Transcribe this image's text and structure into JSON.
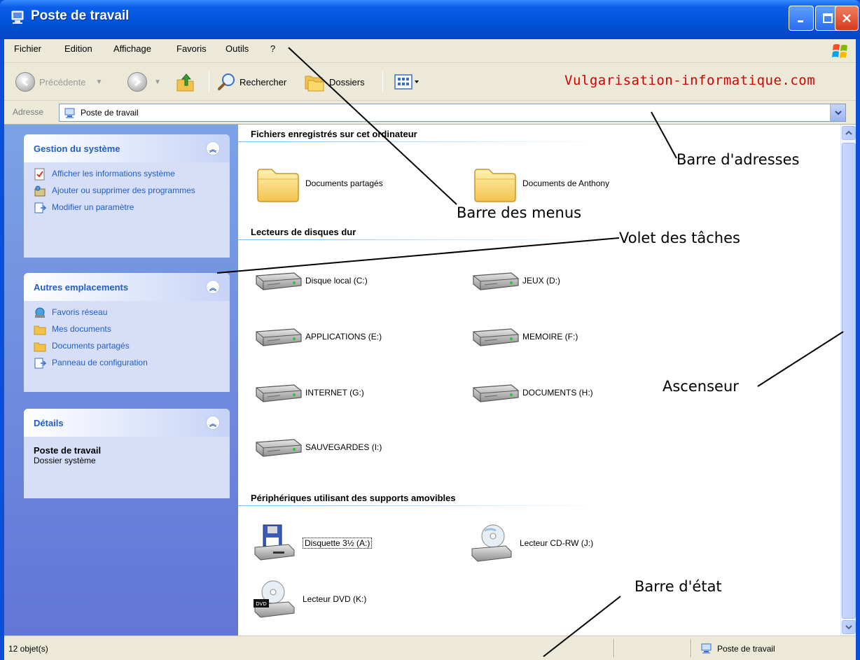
{
  "window": {
    "title": "Poste de travail",
    "title_icon": "computer-icon",
    "controls": [
      "minimize-icon",
      "maximize-icon",
      "close-icon"
    ]
  },
  "menubar": {
    "items": [
      "Fichier",
      "Edition",
      "Affichage",
      "Favoris",
      "Outils",
      "?"
    ]
  },
  "toolbar": {
    "back_label": "Précédente",
    "search_label": "Rechercher",
    "folders_label": "Dossiers",
    "brand": "Vulgarisation-informatique.com",
    "brand_color": "#d40000"
  },
  "address": {
    "label": "Adresse",
    "value": "Poste de travail"
  },
  "tasks": {
    "system": {
      "title": "Gestion du système",
      "items": [
        {
          "label": "Afficher les informations système",
          "icon": "info-icon"
        },
        {
          "label": "Ajouter ou supprimer des programmes",
          "icon": "add-remove-icon"
        },
        {
          "label": "Modifier un paramètre",
          "icon": "control-panel-icon"
        }
      ]
    },
    "places": {
      "title": "Autres emplacements",
      "items": [
        {
          "label": "Favoris réseau",
          "icon": "network-icon"
        },
        {
          "label": "Mes documents",
          "icon": "folder-icon"
        },
        {
          "label": "Documents partagés",
          "icon": "folder-icon"
        },
        {
          "label": "Panneau de configuration",
          "icon": "control-panel-icon"
        }
      ]
    },
    "details": {
      "title": "Détails",
      "name": "Poste de travail",
      "type": "Dossier système"
    }
  },
  "content": {
    "groups": [
      {
        "title": "Fichiers enregistrés sur cet ordinateur",
        "items": [
          "Documents partagés",
          "Documents de Anthony"
        ]
      },
      {
        "title": "Lecteurs de disques dur",
        "items": [
          "Disque local (C:)",
          "JEUX (D:)",
          "APPLICATIONS (E:)",
          "MEMOIRE (F:)",
          "INTERNET (G:)",
          "DOCUMENTS (H:)",
          "SAUVEGARDES (I:)"
        ]
      },
      {
        "title": "Périphériques utilisant des supports amovibles",
        "items": [
          "Disquette 3½ (A:)",
          "Lecteur CD-RW (J:)",
          "Lecteur DVD (K:)"
        ]
      }
    ]
  },
  "statusbar": {
    "count": "12 objet(s)",
    "location": "Poste de travail"
  },
  "annotations": {
    "address_bar": "Barre d'adresses",
    "menu_bar": "Barre des menus",
    "task_pane": "Volet des tâches",
    "scrollbar": "Ascenseur",
    "status_bar": "Barre d'état"
  }
}
